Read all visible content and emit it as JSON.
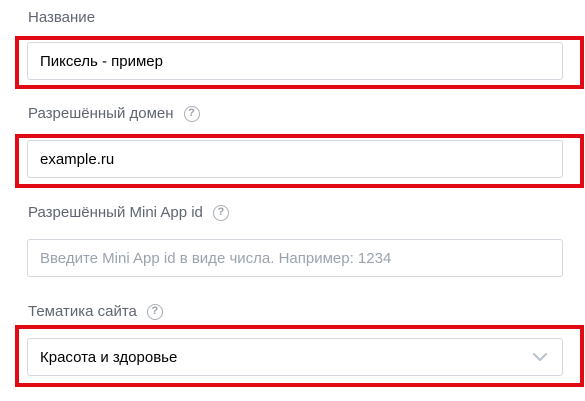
{
  "form": {
    "name": {
      "label": "Название",
      "value": "Пиксель - пример"
    },
    "domain": {
      "label": "Разрешённый домен",
      "help_icon": "question-circle-icon",
      "value": "example.ru"
    },
    "mini_app": {
      "label": "Разрешённый Mini App id",
      "help_icon": "question-circle-icon",
      "placeholder": "Введите Mini App id в виде числа. Например: 1234"
    },
    "topic": {
      "label": "Тематика сайта",
      "help_icon": "question-circle-icon",
      "selected": "Красота и здоровье",
      "dropdown_icon": "chevron-down-icon"
    },
    "help_glyph": "?"
  },
  "colors": {
    "highlight": "#e10a14",
    "label_text": "#5f6670",
    "field_border": "#d3d9de",
    "placeholder_text": "#9aa3ad"
  }
}
